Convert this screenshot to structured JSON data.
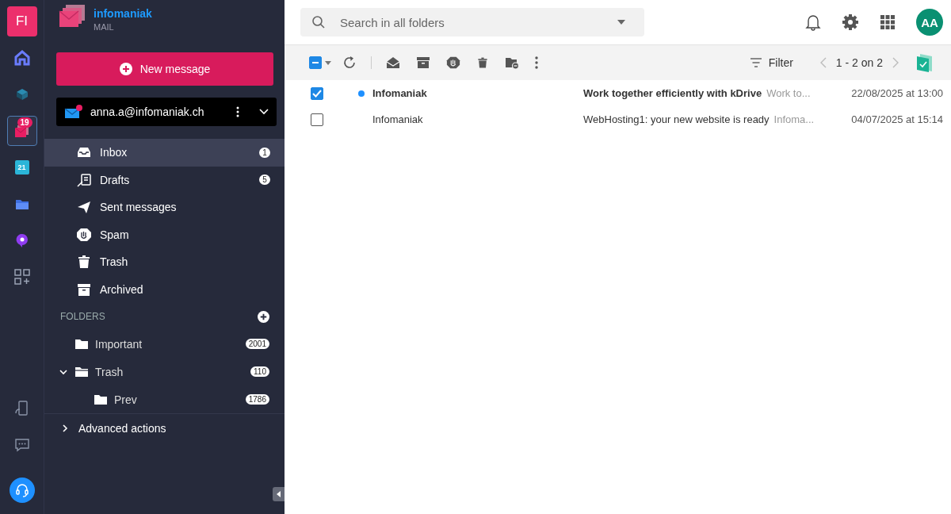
{
  "rail": {
    "initials": "FI",
    "apps": [
      {
        "kind": "home",
        "selected": false
      },
      {
        "kind": "cube",
        "selected": false
      },
      {
        "kind": "mail",
        "selected": true,
        "badge": "19"
      },
      {
        "kind": "calendar",
        "selected": false,
        "text": "21"
      },
      {
        "kind": "drive",
        "selected": false
      },
      {
        "kind": "chat",
        "selected": false
      },
      {
        "kind": "grid",
        "selected": false
      }
    ],
    "bottom": [
      {
        "kind": "device"
      },
      {
        "kind": "message"
      },
      {
        "kind": "support"
      }
    ]
  },
  "brand": {
    "name": "infomaniak",
    "product": "MAIL"
  },
  "new_message": "New message",
  "account": {
    "email": "anna.a@infomaniak.ch"
  },
  "mailboxes": [
    {
      "kind": "inbox",
      "label": "Inbox",
      "count": "1",
      "selected": true
    },
    {
      "kind": "drafts",
      "label": "Drafts",
      "count": "5",
      "selected": false
    },
    {
      "kind": "sent",
      "label": "Sent messages",
      "selected": false
    },
    {
      "kind": "spam",
      "label": "Spam",
      "selected": false
    },
    {
      "kind": "trash",
      "label": "Trash",
      "selected": false
    },
    {
      "kind": "archive",
      "label": "Archived",
      "selected": false
    }
  ],
  "folders": {
    "heading": "FOLDERS",
    "items": [
      {
        "label": "Important",
        "count": "2001",
        "expanded": false
      },
      {
        "label": "Trash",
        "count": "110",
        "expanded": true,
        "children": [
          {
            "label": "Prev",
            "count": "1786",
            "expanded": false
          }
        ]
      }
    ]
  },
  "advanced": {
    "label": "Advanced actions",
    "expanded": false
  },
  "search": {
    "placeholder": "Search in all folders"
  },
  "user": {
    "initials": "AA"
  },
  "toolbar": {
    "select_all": {
      "indeterminate": true
    },
    "filter": "Filter",
    "pager": "1 - 2 on 2"
  },
  "messages": [
    {
      "sender": "Infomaniak",
      "subject": "Work together efficiently with kDrive",
      "preview": "Work to...",
      "date": "22/08/2025 at 13:00",
      "unread": true,
      "checked": true
    },
    {
      "sender": "Infomaniak",
      "subject": "WebHosting1: your new website is ready",
      "preview": "Infoma...",
      "date": "04/07/2025 at 15:14",
      "unread": false,
      "checked": false
    }
  ]
}
